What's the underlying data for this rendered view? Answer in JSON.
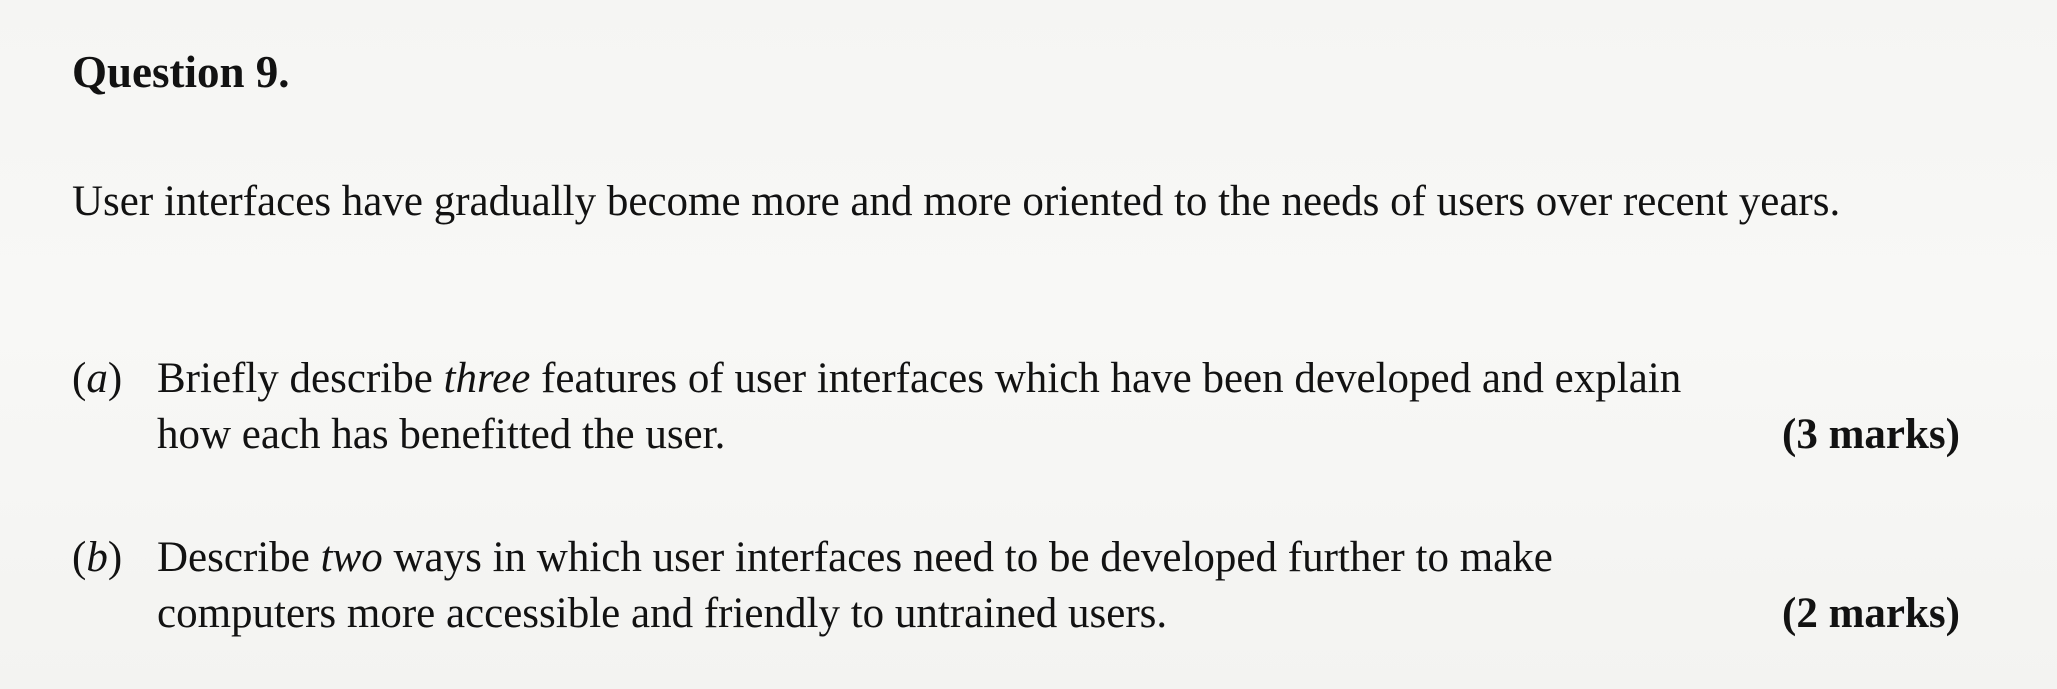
{
  "question": {
    "title": "Question 9.",
    "intro": "User interfaces have gradually become more and more oriented to the needs of users over recent years.",
    "parts": [
      {
        "label_open": "(",
        "label_letter": "a",
        "label_close": ")",
        "line1_before": "Briefly describe ",
        "line1_emphasis": "three",
        "line1_after": " features of user interfaces which have been developed and explain",
        "line2": "how each has benefitted the user.",
        "marks": "(3 marks)"
      },
      {
        "label_open": "(",
        "label_letter": "b",
        "label_close": ")",
        "line1_before": "Describe ",
        "line1_emphasis": "two",
        "line1_after": " ways in which user interfaces need to be developed further to make",
        "line2": "computers more accessible and friendly to untrained users.",
        "marks": "(2 marks)"
      }
    ]
  }
}
